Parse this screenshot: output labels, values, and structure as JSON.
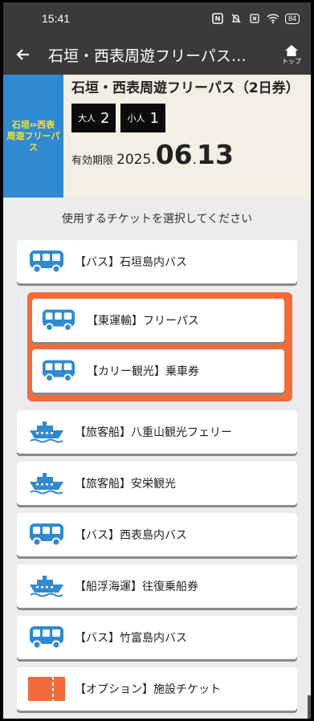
{
  "status": {
    "time": "15:41",
    "battery": "84"
  },
  "appbar": {
    "title": "石垣・西表周遊フリーパス…",
    "home_label": "トップ"
  },
  "pass": {
    "logo_line1": "石垣⇔西表",
    "logo_line2": "周遊フリーパス",
    "name": "石垣・西表周遊フリーパス（2日券）",
    "adult_label": "大人",
    "adult_count": "2",
    "child_label": "小人",
    "child_count": "1",
    "validity_label": "有効期限",
    "year": "2025",
    "dot": ".",
    "month": "06",
    "day": "13"
  },
  "instruction": "使用するチケットを選択してください",
  "tickets": [
    {
      "label": "【バス】石垣島内バス",
      "icon": "bus-icon"
    },
    {
      "label": "【東運輸】フリーパス",
      "icon": "bus-icon",
      "highlighted": true
    },
    {
      "label": "【カリー観光】乗車券",
      "icon": "bus-icon",
      "highlighted": true
    },
    {
      "label": "【旅客船】八重山観光フェリー",
      "icon": "ship-icon"
    },
    {
      "label": "【旅客船】安栄観光",
      "icon": "ship-icon"
    },
    {
      "label": "【バス】西表島内バス",
      "icon": "bus-icon"
    },
    {
      "label": "【船浮海運】往復乗船券",
      "icon": "ship-icon"
    },
    {
      "label": "【バス】竹富島内バス",
      "icon": "bus-icon"
    },
    {
      "label": "【オプション】施設チケット",
      "icon": "ticket-icon"
    }
  ],
  "colors": {
    "highlight": "#f26b3a",
    "bus": "#2f8ad2",
    "ship": "#2f8ad2",
    "ticket": "#f26b3a"
  }
}
